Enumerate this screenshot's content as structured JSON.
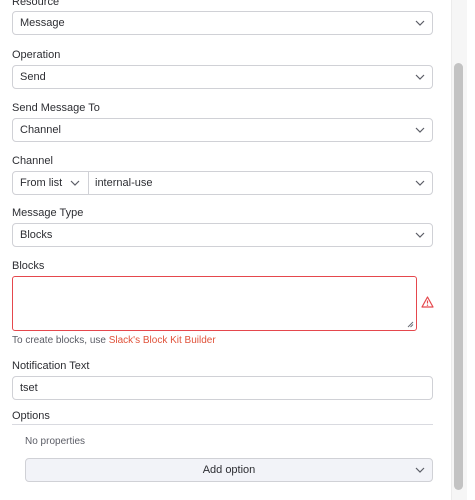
{
  "fields": {
    "resource": {
      "label": "Resource",
      "value": "Message"
    },
    "operation": {
      "label": "Operation",
      "value": "Send"
    },
    "send_message_to": {
      "label": "Send Message To",
      "value": "Channel"
    },
    "channel": {
      "label": "Channel",
      "mode": "From list",
      "value": "internal-use"
    },
    "message_type": {
      "label": "Message Type",
      "value": "Blocks"
    },
    "blocks": {
      "label": "Blocks",
      "value": "",
      "hint_prefix": "To create blocks, use ",
      "hint_link": "Slack's Block Kit Builder"
    },
    "notification_text": {
      "label": "Notification Text",
      "value": "tset"
    }
  },
  "options": {
    "label": "Options",
    "empty_text": "No properties",
    "add_button": "Add option"
  },
  "colors": {
    "error": "#e5484d",
    "link": "#e0533b",
    "border": "#d0d1d6"
  },
  "icons": {
    "dropdown": "chevron-down-icon",
    "warning": "warning-triangle-icon",
    "resize": "resize-handle-icon"
  }
}
